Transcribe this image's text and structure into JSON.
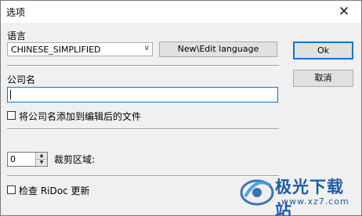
{
  "window": {
    "title": "选项",
    "close_glyph": "✕"
  },
  "language": {
    "label": "语言",
    "selected": "CHINESE_SIMPLIFIED",
    "edit_button": "New\\Edit language"
  },
  "buttons": {
    "ok": "Ok",
    "cancel": "取消"
  },
  "company": {
    "label": "公司名",
    "value": "",
    "add_checkbox_label": "将公司名添加到编辑后的文件",
    "add_checkbox_checked": false
  },
  "crop": {
    "value": "0",
    "label": "裁剪区域:"
  },
  "update": {
    "checkbox_label": "检查 RiDoc 更新",
    "checked": false
  },
  "watermark": {
    "brand": "极光下载站",
    "url": "www.xz7.com"
  },
  "colors": {
    "accent": "#0078d7",
    "brand": "#1e5aa8"
  }
}
